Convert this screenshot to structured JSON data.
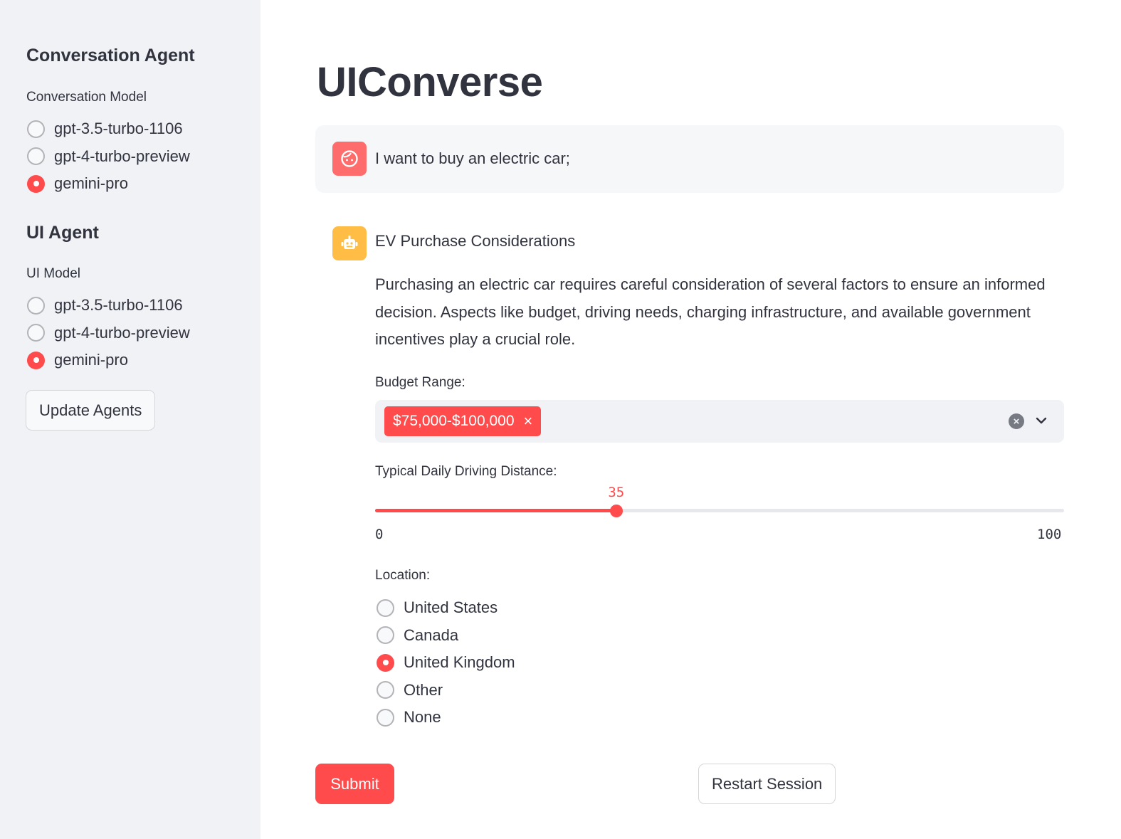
{
  "sidebar": {
    "conversation_agent": {
      "title": "Conversation Agent",
      "label": "Conversation Model",
      "options": [
        "gpt-3.5-turbo-1106",
        "gpt-4-turbo-preview",
        "gemini-pro"
      ],
      "selected": "gemini-pro"
    },
    "ui_agent": {
      "title": "UI Agent",
      "label": "UI Model",
      "options": [
        "gpt-3.5-turbo-1106",
        "gpt-4-turbo-preview",
        "gemini-pro"
      ],
      "selected": "gemini-pro"
    },
    "update_button": "Update Agents"
  },
  "main": {
    "title": "UIConverse",
    "user_message": {
      "avatar_icon": "user-face-icon",
      "text": "I want to buy an electric car;"
    },
    "assistant_message": {
      "avatar_icon": "robot-icon",
      "heading": "EV Purchase Considerations",
      "paragraph": "Purchasing an electric car requires careful consideration of several factors to ensure an informed decision. Aspects like budget, driving needs, charging infrastructure, and available government incentives play a crucial role."
    },
    "budget": {
      "label": "Budget Range:",
      "selected_tags": [
        "$75,000-$100,000"
      ],
      "tag_remove_glyph": "×",
      "clear_glyph": "×"
    },
    "distance": {
      "label": "Typical Daily Driving Distance:",
      "value": 35,
      "value_label": "35",
      "min": 0,
      "max": 100,
      "min_label": "0",
      "max_label": "100"
    },
    "location": {
      "label": "Location:",
      "options": [
        "United States",
        "Canada",
        "United Kingdom",
        "Other",
        "None"
      ],
      "selected": "United Kingdom"
    },
    "submit_button": "Submit",
    "restart_button": "Restart Session"
  },
  "colors": {
    "primary": "#ff4b4b",
    "sidebar_bg": "#f0f2f6",
    "text": "#31333f",
    "user_avatar": "#ff6c6c",
    "bot_avatar": "#ffbd45"
  }
}
